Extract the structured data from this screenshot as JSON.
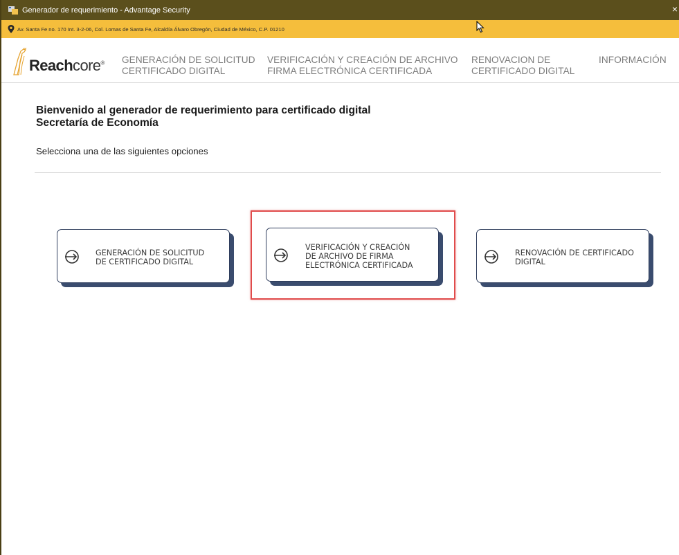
{
  "window": {
    "title": "Generador de requerimiento - Advantage Security",
    "close_glyph": "×",
    "icon": "app-icon"
  },
  "address_bar": {
    "text": "Av. Santa Fe no. 170 Int. 3-2-06, Col. Lomas de Santa Fe, Alcaldía Álvaro Obregón, Ciudad de México, C.P. 01210",
    "icon": "location-pin-icon"
  },
  "logo": {
    "text_bold": "Reach",
    "text_regular": "core",
    "registered": "®"
  },
  "nav": [
    {
      "line1": "GENERACIÓN DE SOLICITUD",
      "line2": "CERTIFICADO DIGITAL"
    },
    {
      "line1": "VERIFICACIÓN Y CREACIÓN DE ARCHIVO",
      "line2": "FIRMA ELECTRÓNICA CERTIFICADA"
    },
    {
      "line1": "RENOVACION DE",
      "line2": "CERTIFICADO DIGITAL"
    },
    {
      "line1": "INFORMACIÓN",
      "line2": ""
    }
  ],
  "main": {
    "welcome_line1": "Bienvenido al generador de requerimiento para certificado digital",
    "welcome_line2": "Secretaría de Economía",
    "subtitle": "Selecciona una de las siguientes opciones"
  },
  "cards": [
    {
      "line1": "GENERACIÓN DE SOLICITUD",
      "line2": "DE CERTIFICADO DIGITAL",
      "line3": "",
      "icon": "arrow-right-circle-icon"
    },
    {
      "line1": "VERIFICACIÓN Y CREACIÓN",
      "line2": "DE ARCHIVO DE FIRMA",
      "line3": "ELECTRÓNICA CERTIFICADA",
      "icon": "arrow-right-circle-icon"
    },
    {
      "line1": "RENOVACIÓN DE CERTIFICADO",
      "line2": "DIGITAL",
      "line3": "",
      "icon": "arrow-right-circle-icon"
    }
  ],
  "colors": {
    "titlebar": "#5b4f1c",
    "address_bar": "#f5be3c",
    "card_shadow": "#3a4c6e",
    "highlight": "#e04b4b"
  }
}
